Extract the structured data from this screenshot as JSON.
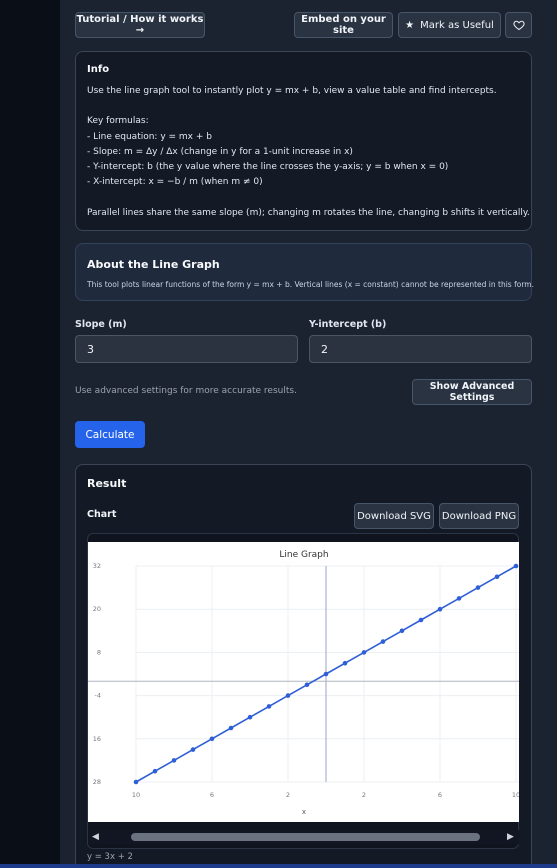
{
  "toolbar": {
    "tutorial_label": "Tutorial / How it works →",
    "embed_label": "Embed on your site",
    "useful_label": "Mark as Useful"
  },
  "info": {
    "title": "Info",
    "lines": [
      "Use the line graph tool to instantly plot y = mx + b, view a value table and find intercepts.",
      "",
      "Key formulas:",
      "- Line equation: y = mx + b",
      "- Slope: m = Δy / Δx (change in y for a 1-unit increase in x)",
      "- Y-intercept: b (the y value where the line crosses the y-axis; y = b when x = 0)",
      "- X-intercept: x = −b / m (when m ≠ 0)",
      "",
      "Parallel lines share the same slope (m); changing m rotates the line, changing b shifts it vertically."
    ]
  },
  "about": {
    "title": "About the Line Graph",
    "text": "This tool plots linear functions of the form y = mx + b. Vertical lines (x = constant) cannot be represented in this form."
  },
  "form": {
    "slope_label": "Slope (m)",
    "slope_value": "3",
    "intercept_label": "Y-intercept (b)",
    "intercept_value": "2",
    "hint": "Use advanced settings for more accurate results.",
    "advanced_label": "Show Advanced Settings",
    "calculate_label": "Calculate"
  },
  "result": {
    "title": "Result",
    "chart_label": "Chart",
    "download_svg": "Download SVG",
    "download_png": "Download PNG",
    "equation": "y = 3x + 2"
  },
  "colors": {
    "accent": "#2563eb",
    "line": "#2f5fd6"
  },
  "chart_data": {
    "type": "line",
    "title": "Line Graph",
    "xlabel": "x",
    "ylabel": "",
    "x": [
      -10,
      -9,
      -8,
      -7,
      -6,
      -5,
      -4,
      -3,
      -2,
      -1,
      0,
      1,
      2,
      3,
      4,
      5,
      6,
      7,
      8,
      9,
      10
    ],
    "series": [
      {
        "values": [
          -28,
          -25,
          -22,
          -19,
          -16,
          -13,
          -10,
          -7,
          -4,
          -1,
          2,
          5,
          8,
          11,
          14,
          17,
          20,
          23,
          26,
          29,
          32
        ]
      }
    ],
    "x_tick_labels": [
      "10",
      "6",
      "2",
      "2",
      "6",
      "10"
    ],
    "x_ticks": [
      -10,
      -6,
      -2,
      2,
      6,
      10
    ],
    "y_tick_labels": [
      "32",
      "20",
      "8",
      "-4",
      "16",
      "28"
    ],
    "y_ticks": [
      32,
      20,
      8,
      -4,
      -16,
      -28
    ],
    "xlim": [
      -10,
      10
    ],
    "ylim": [
      -28,
      32
    ],
    "grid": true
  }
}
